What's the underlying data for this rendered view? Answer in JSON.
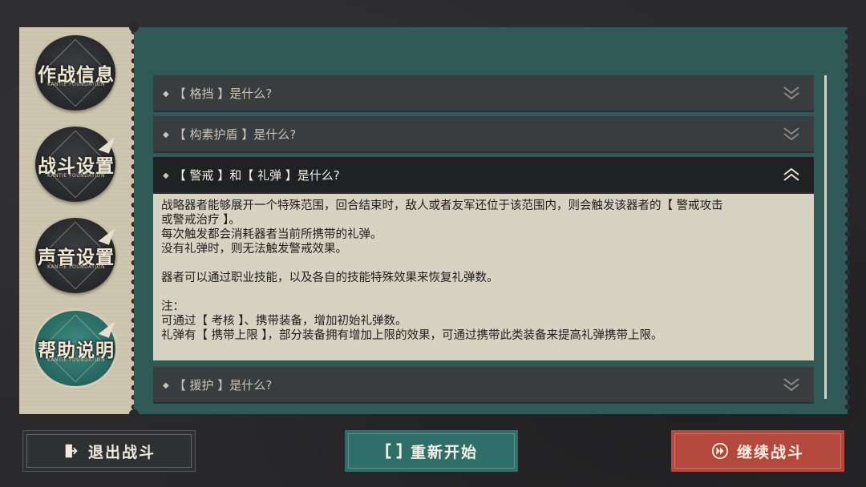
{
  "sidebar": {
    "tabs": [
      {
        "label": "作战信息",
        "sub": "KANTIE FOUNDATION"
      },
      {
        "label": "战斗设置",
        "sub": "KANTIE FOUNDATION"
      },
      {
        "label": "声音设置",
        "sub": "KANTIE FOUNDATION"
      },
      {
        "label": "帮助说明",
        "sub": "KANTIE FOUNDATION",
        "active": true
      }
    ]
  },
  "faq": {
    "items": [
      {
        "question": "【 格挡 】是什么?",
        "expanded": false
      },
      {
        "question": "【 构素护盾 】是什么?",
        "expanded": false
      },
      {
        "question": "【 警戒 】和【 礼弹 】是什么?",
        "expanded": true
      },
      {
        "question": "【 援护 】是什么?",
        "expanded": false
      }
    ],
    "answer": {
      "line1": "战略器者能够展开一个特殊范围，回合结束时，敌人或者友军还位于该范围内，则会触发该器者的【 警戒攻击",
      "line2": "或警戒治疗 】。",
      "line3": "每次触发都会消耗器者当前所携带的礼弹。",
      "line4": "没有礼弹时，则无法触发警戒效果。",
      "line5": "器者可以通过职业技能，以及各自的技能特殊效果来恢复礼弹数。",
      "line6": "注：",
      "line7": "可通过【 考核 】、携带装备，增加初始礼弹数。",
      "line8": "礼弹有【 携带上限 】，部分装备拥有增加上限的效果，可通过携带此类装备来提高礼弹携带上限。"
    }
  },
  "buttons": {
    "exit": "退出战斗",
    "restart": "重新开始",
    "continue": "继续战斗"
  },
  "colors": {
    "panel": "#2f5a58",
    "restart": "#2f6e69",
    "continue": "#b5483c",
    "answer_bg": "#d8d2c3"
  },
  "icons": {
    "exit": "exit-door-icon",
    "restart": "restart-brackets-icon",
    "continue": "fast-forward-icon",
    "collapsed": "chevron-double-down-icon",
    "expanded": "chevron-double-up-icon"
  }
}
